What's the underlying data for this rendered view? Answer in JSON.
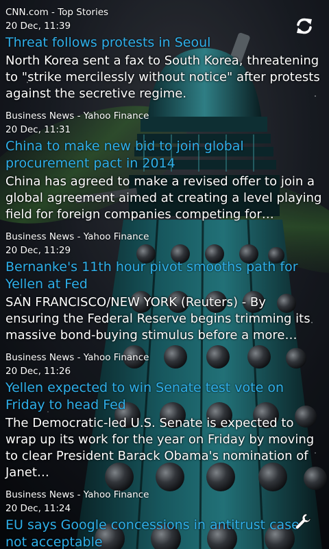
{
  "widget": {
    "refresh_icon": "refresh-icon",
    "settings_icon": "wrench-icon",
    "accent_color": "#2fb0ea",
    "text_color": "#ffffff"
  },
  "items": [
    {
      "source": "CNN.com - Top Stories",
      "time": "20 Dec, 11:39",
      "title": "Threat follows protests in Seoul",
      "summary": "North Korea sent a fax to South Korea, threatening to \"strike mercilessly without notice\" after protests against the secretive regime."
    },
    {
      "source": "Business News - Yahoo Finance",
      "time": "20 Dec, 11:31",
      "title": "China to make new bid to join global procurement pact in 2014",
      "summary": "China has agreed to make a revised offer to join a global agreement aimed at creating a level playing field for foreign companies competing for…"
    },
    {
      "source": "Business News - Yahoo Finance",
      "time": "20 Dec, 11:29",
      "title": "Bernanke's 11th hour pivot smooths path for Yellen at Fed",
      "summary": "SAN FRANCISCO/NEW YORK (Reuters) - By ensuring the Federal Reserve begins trimming its massive bond-buying stimulus before a more…"
    },
    {
      "source": "Business News - Yahoo Finance",
      "time": "20 Dec, 11:26",
      "title": "Yellen expected to win Senate test vote on Friday to head Fed",
      "summary": "The Democratic-led U.S. Senate is expected to wrap up its work for the year on Friday by moving to clear President Barack Obama's nomination of Janet…"
    },
    {
      "source": "Business News - Yahoo Finance",
      "time": "20 Dec, 11:24",
      "title": "EU says Google concessions in antitrust case not acceptable",
      "summary": ""
    }
  ]
}
